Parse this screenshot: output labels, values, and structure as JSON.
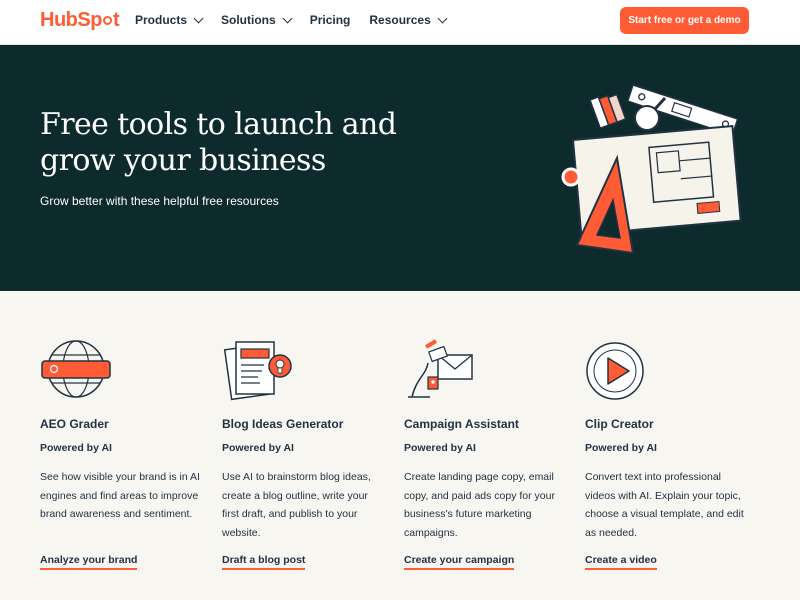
{
  "header": {
    "logo_text_a": "Hub",
    "logo_text_b": "Sp",
    "logo_text_c": "t",
    "nav": [
      {
        "label": "Products",
        "icon": "chevron-down-icon"
      },
      {
        "label": "Solutions",
        "icon": "chevron-down-icon"
      },
      {
        "label": "Pricing"
      },
      {
        "label": "Resources",
        "icon": "chevron-down-icon"
      }
    ],
    "cta_label": "Start free or get a demo"
  },
  "hero": {
    "title": "Free tools to launch and grow your business",
    "subtitle": "Grow better with these helpful free resources",
    "illustration": "blueprint-tools-illustration"
  },
  "tools": [
    {
      "icon": "globe-search-icon",
      "title": "AEO Grader",
      "powered": "Powered by AI",
      "description": "See how visible your brand is in AI engines and find areas to improve brand awareness and sentiment.",
      "link": "Analyze your brand"
    },
    {
      "icon": "document-lightbulb-icon",
      "title": "Blog Ideas Generator",
      "powered": "Powered by AI",
      "description": "Use AI to brainstorm blog ideas, create a blog outline, write your first draft, and publish to your website.",
      "link": "Draft a blog post"
    },
    {
      "icon": "email-campaign-icon",
      "title": "Campaign Assistant",
      "powered": "Powered by AI",
      "description": "Create landing page copy, email copy, and paid ads copy for your business's future marketing campaigns.",
      "link": "Create your campaign"
    },
    {
      "icon": "play-icon",
      "title": "Clip Creator",
      "powered": "Powered by AI",
      "description": "Convert text into professional videos with AI. Explain your topic, choose a visual template, and edit as needed.",
      "link": "Create a video"
    }
  ],
  "colors": {
    "brand": "#ff5c35",
    "hero_bg": "#0d2a2c",
    "text": "#213343",
    "page_bg": "#f8f6f1"
  }
}
